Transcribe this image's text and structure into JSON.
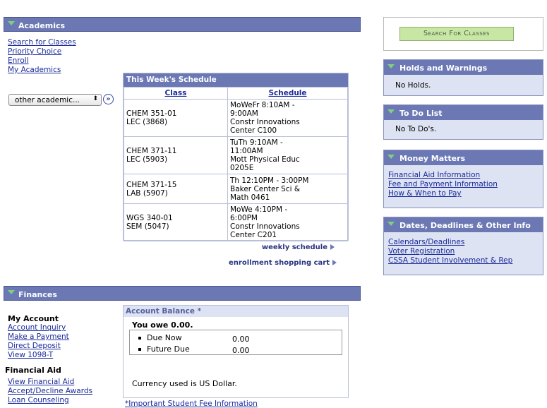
{
  "academics": {
    "title": "Academics",
    "links": [
      "Search for Classes",
      "Priority Choice",
      "Enroll",
      "My Academics"
    ],
    "select_value": "other academic...",
    "schedule": {
      "title": "This Week's Schedule",
      "col_class": "Class",
      "col_schedule": "Schedule",
      "rows": [
        {
          "class1": "CHEM 351-01",
          "class2": "LEC (3868)",
          "s1": "MoWeFr 8:10AM -",
          "s2": "9:00AM",
          "s3": "Constr Innovations",
          "s4": "Center C100"
        },
        {
          "class1": "CHEM 371-11",
          "class2": "LEC (5903)",
          "s1": "TuTh 9:10AM -",
          "s2": "11:00AM",
          "s3": "Mott Physical Educ",
          "s4": "0205E"
        },
        {
          "class1": "CHEM 371-15",
          "class2": "LAB (5907)",
          "s1": "Th 12:10PM - 3:00PM",
          "s2": "Baker Center Sci &",
          "s3": "Math 0461",
          "s4": ""
        },
        {
          "class1": "WGS 340-01",
          "class2": "SEM (5047)",
          "s1": "MoWe 4:10PM -",
          "s2": "6:00PM",
          "s3": "Constr Innovations",
          "s4": "Center C201"
        }
      ]
    },
    "weekly_schedule": "weekly schedule",
    "shopping_cart": "enrollment shopping cart"
  },
  "finances": {
    "title": "Finances",
    "my_account_heading": "My Account",
    "my_account_links": [
      "Account Inquiry",
      "Make a Payment",
      "Direct Deposit",
      "View 1098-T"
    ],
    "financial_aid_heading": "Financial Aid",
    "financial_aid_links": [
      "View Financial Aid",
      "Accept/Decline Awards",
      "Loan Counseling"
    ],
    "balance": {
      "title": "Account Balance *",
      "owe": "You owe 0.00.",
      "due_now_label": "Due Now",
      "due_now_value": "0.00",
      "future_due_label": "Future Due",
      "future_due_value": "0.00",
      "currency": "Currency used is US Dollar.",
      "fee_link": "*Important Student Fee Information"
    }
  },
  "search_button": "Search For Classes",
  "holds": {
    "title": "Holds and Warnings",
    "body": "No Holds."
  },
  "todo": {
    "title": "To Do List",
    "body": "No To Do's."
  },
  "money": {
    "title": "Money Matters",
    "links": [
      "Financial Aid Information",
      "Fee and Payment Information",
      "How & When to Pay"
    ]
  },
  "dates": {
    "title": "Dates, Deadlines & Other Info",
    "links": [
      "Calendars/Deadlines",
      "Voter Registration",
      "CSSA Student Involvement & Rep"
    ]
  }
}
